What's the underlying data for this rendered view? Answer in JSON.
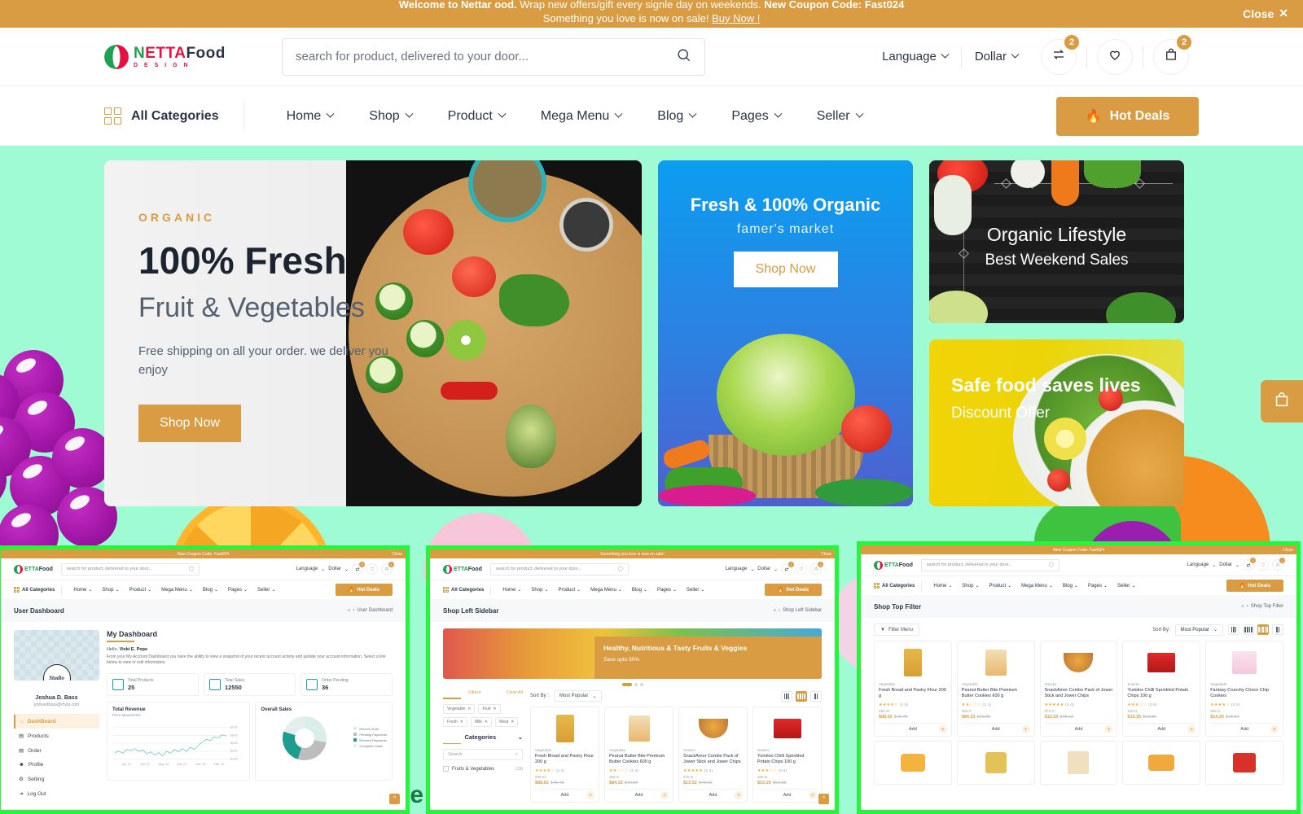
{
  "promo": {
    "line1_a": "Welcome to Nettar ood.",
    "line1_b": " Wrap new offers/gift every signle day on weekends. ",
    "line1_c": "New Coupon Code: Fast024",
    "line2_a": "Something you love is now on sale! ",
    "line2_b": "Buy Now !",
    "close": "Close"
  },
  "header": {
    "logo": {
      "n1": "N",
      "netta": "ETTA",
      "food": "Food",
      "sub": "D E S I G N"
    },
    "search": {
      "value": "",
      "placeholder": "search for product, delivered to your door..."
    },
    "language": "Language",
    "currency": "Dollar",
    "compare_badge": "2",
    "cart_badge": "2",
    "icons": {
      "search": "search-icon",
      "compare": "compare-icon",
      "wishlist": "heart-icon",
      "cart": "bag-icon"
    }
  },
  "nav": {
    "all_categories": "All Categories",
    "links": [
      "Home",
      "Shop",
      "Product",
      "Mega Menu",
      "Blog",
      "Pages",
      "Seller"
    ],
    "hot_deals": "Hot Deals"
  },
  "hero": {
    "eyebrow": "ORGANIC",
    "title": "100% Fresh",
    "subtitle": "Fruit & Vegetables",
    "desc": "Free shipping on all your order. we deliver you enjoy",
    "button": "Shop Now"
  },
  "promo_mid": {
    "title": "Fresh & 100% Organic",
    "subtitle": "famer's market",
    "button": "Shop Now"
  },
  "promo_dark": {
    "title": "Organic Lifestyle",
    "subtitle": "Best Weekend Sales"
  },
  "promo_yellow": {
    "title": "Safe food saves lives",
    "subtitle": "Discount Offer"
  },
  "floating": {
    "cart_icon": "bag-icon"
  },
  "previews": [
    {
      "breadcrumb_title": "User Dashboard",
      "breadcrumb_path": "User Dashboard",
      "dashboard": {
        "avatar_label": "Studio",
        "user_name": "Joshua D. Bass",
        "user_email": "joshuedbass@rhyta.com",
        "menu": [
          "DashBoard",
          "Products",
          "Order",
          "Profile",
          "Setting",
          "Log Out"
        ],
        "title": "My Dashboard",
        "hello_prefix": "Hello,",
        "hello_name": "Vicki E. Pope",
        "description": "From your My Account Dashboard you have the ability to view a snapshot of your recent account activity and update your account information. Select a link below to view or edit information.",
        "stats": [
          {
            "label": "Total Products",
            "value": "25"
          },
          {
            "label": "Total Sales",
            "value": "12550"
          },
          {
            "label": "Order Pending",
            "value": "36"
          }
        ],
        "revenue": {
          "title": "Total Revenue",
          "subtitle": "Price Movements",
          "y_ticks": [
            "42.00",
            "39.00",
            "36.00",
            "33.00",
            "30.00",
            "27.00"
          ],
          "x_ticks": [
            "Apr '12",
            "Jun '12",
            "Aug '12",
            "Oct '12",
            "Dec '12",
            "Feb '13"
          ]
        },
        "overall": {
          "title": "Overall Sales",
          "legend": [
            "Recent Order",
            "Pending Payments",
            "Recived Payments",
            "Complete Order"
          ]
        }
      }
    },
    {
      "breadcrumb_title": "Shop Left Sidebar",
      "breadcrumb_path": "Shop Left Sidebar",
      "banner": {
        "title": "Healthy, Nutritious & Tasty Fruits & Veggies",
        "subtitle": "Save upto 50%"
      },
      "filters": {
        "title": "Filters",
        "clear": "Clear All",
        "tags": [
          "Vegetable",
          "Fruit",
          "Fresh",
          "Milk",
          "Meat"
        ],
        "categories_title": "Categories",
        "search_placeholder": "Search",
        "items": [
          {
            "label": "Fruits & Vegetables",
            "count": "(13)"
          }
        ]
      },
      "sort_label": "Sort By :",
      "sort_value": "Most Popular",
      "products": [
        {
          "cat": "Vegetable",
          "name": "Fresh Bread and Pastry Flour 200 g",
          "rating": "(4.0)",
          "stars": 4,
          "size": "200 ml",
          "price": "$88.02",
          "old": "$45.45",
          "add": "Add"
        },
        {
          "cat": "Vegetable",
          "name": "Peanut Butter Bite Premium Butter Cookies 600 g",
          "rating": "(2.4)",
          "stars": 2,
          "size": "350 G",
          "price": "$84.33",
          "old": "$40.86",
          "add": "Add"
        },
        {
          "cat": "Snacks",
          "name": "SnackAmor Combo Pack of Jower Stick and Jower Chips",
          "rating": "(5.0)",
          "stars": 5,
          "size": "570 G",
          "price": "$12.52",
          "old": "$48.62",
          "add": "Add"
        },
        {
          "cat": "Snacks",
          "name": "Yumitos Chilli Sprinkled Potato Chips 100 g",
          "rating": "(3.8)",
          "stars": 3,
          "size": "100 G",
          "price": "$10.25",
          "old": "$62.86",
          "add": "Add"
        }
      ]
    },
    {
      "breadcrumb_title": "Shop Top Filter",
      "breadcrumb_path": "Shop Top Filter",
      "filter_menu": "Filter Menu",
      "sort_label": "Sort By:",
      "sort_value": "Most Popular",
      "products": [
        {
          "cat": "Vegetable",
          "name": "Fresh Bread and Pastry Flour 200 g",
          "rating": "(4.0)",
          "stars": 4,
          "size": "250 ml",
          "price": "$88.02",
          "old": "$45.45",
          "add": "Add"
        },
        {
          "cat": "Vegetable",
          "name": "Peanut Butter Bite Premium Butter Cookies 600 g",
          "rating": "(2.4)",
          "stars": 2,
          "size": "350 G",
          "price": "$84.33",
          "old": "$40.86",
          "add": "Add"
        },
        {
          "cat": "Snacks",
          "name": "SnackAmor Combo Pack of Jower Stick and Jower Chips",
          "rating": "(5.0)",
          "stars": 5,
          "size": "570 G",
          "price": "$12.52",
          "old": "$48.62",
          "add": "Add"
        },
        {
          "cat": "Snacks",
          "name": "Yumitos Chilli Sprinkled Potato Chips 100 g",
          "rating": "(3.8)",
          "stars": 3,
          "size": "100 G",
          "price": "$10.25",
          "old": "$62.86",
          "add": "Add"
        },
        {
          "cat": "Vegetable",
          "name": "Fantasy Crunchy Choco Chip Cookies",
          "rating": "(4.0)",
          "stars": 4,
          "size": "554 G",
          "price": "$14.25",
          "old": "$46.57",
          "add": "Add"
        }
      ]
    }
  ],
  "colors": {
    "accent": "#d99c42",
    "bg": "#9ffbd3",
    "preview_border": "#27f53c",
    "teal": "#17a398"
  }
}
